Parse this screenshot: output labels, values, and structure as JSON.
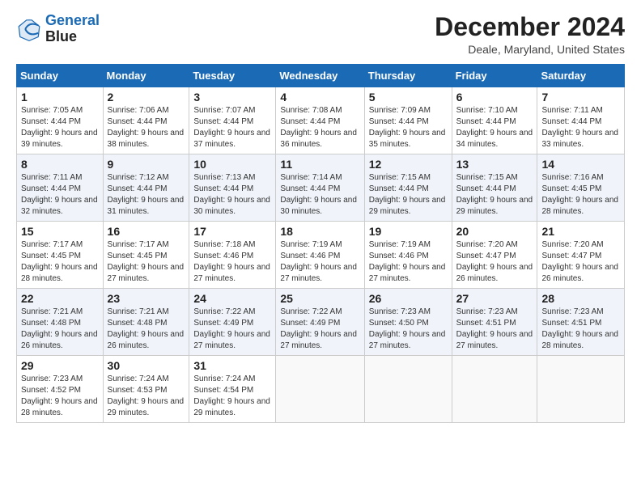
{
  "logo": {
    "line1": "General",
    "line2": "Blue"
  },
  "title": "December 2024",
  "location": "Deale, Maryland, United States",
  "days_of_week": [
    "Sunday",
    "Monday",
    "Tuesday",
    "Wednesday",
    "Thursday",
    "Friday",
    "Saturday"
  ],
  "weeks": [
    [
      {
        "day": "1",
        "sunrise": "7:05 AM",
        "sunset": "4:44 PM",
        "daylight": "9 hours and 39 minutes."
      },
      {
        "day": "2",
        "sunrise": "7:06 AM",
        "sunset": "4:44 PM",
        "daylight": "9 hours and 38 minutes."
      },
      {
        "day": "3",
        "sunrise": "7:07 AM",
        "sunset": "4:44 PM",
        "daylight": "9 hours and 37 minutes."
      },
      {
        "day": "4",
        "sunrise": "7:08 AM",
        "sunset": "4:44 PM",
        "daylight": "9 hours and 36 minutes."
      },
      {
        "day": "5",
        "sunrise": "7:09 AM",
        "sunset": "4:44 PM",
        "daylight": "9 hours and 35 minutes."
      },
      {
        "day": "6",
        "sunrise": "7:10 AM",
        "sunset": "4:44 PM",
        "daylight": "9 hours and 34 minutes."
      },
      {
        "day": "7",
        "sunrise": "7:11 AM",
        "sunset": "4:44 PM",
        "daylight": "9 hours and 33 minutes."
      }
    ],
    [
      {
        "day": "8",
        "sunrise": "7:11 AM",
        "sunset": "4:44 PM",
        "daylight": "9 hours and 32 minutes."
      },
      {
        "day": "9",
        "sunrise": "7:12 AM",
        "sunset": "4:44 PM",
        "daylight": "9 hours and 31 minutes."
      },
      {
        "day": "10",
        "sunrise": "7:13 AM",
        "sunset": "4:44 PM",
        "daylight": "9 hours and 30 minutes."
      },
      {
        "day": "11",
        "sunrise": "7:14 AM",
        "sunset": "4:44 PM",
        "daylight": "9 hours and 30 minutes."
      },
      {
        "day": "12",
        "sunrise": "7:15 AM",
        "sunset": "4:44 PM",
        "daylight": "9 hours and 29 minutes."
      },
      {
        "day": "13",
        "sunrise": "7:15 AM",
        "sunset": "4:44 PM",
        "daylight": "9 hours and 29 minutes."
      },
      {
        "day": "14",
        "sunrise": "7:16 AM",
        "sunset": "4:45 PM",
        "daylight": "9 hours and 28 minutes."
      }
    ],
    [
      {
        "day": "15",
        "sunrise": "7:17 AM",
        "sunset": "4:45 PM",
        "daylight": "9 hours and 28 minutes."
      },
      {
        "day": "16",
        "sunrise": "7:17 AM",
        "sunset": "4:45 PM",
        "daylight": "9 hours and 27 minutes."
      },
      {
        "day": "17",
        "sunrise": "7:18 AM",
        "sunset": "4:46 PM",
        "daylight": "9 hours and 27 minutes."
      },
      {
        "day": "18",
        "sunrise": "7:19 AM",
        "sunset": "4:46 PM",
        "daylight": "9 hours and 27 minutes."
      },
      {
        "day": "19",
        "sunrise": "7:19 AM",
        "sunset": "4:46 PM",
        "daylight": "9 hours and 27 minutes."
      },
      {
        "day": "20",
        "sunrise": "7:20 AM",
        "sunset": "4:47 PM",
        "daylight": "9 hours and 26 minutes."
      },
      {
        "day": "21",
        "sunrise": "7:20 AM",
        "sunset": "4:47 PM",
        "daylight": "9 hours and 26 minutes."
      }
    ],
    [
      {
        "day": "22",
        "sunrise": "7:21 AM",
        "sunset": "4:48 PM",
        "daylight": "9 hours and 26 minutes."
      },
      {
        "day": "23",
        "sunrise": "7:21 AM",
        "sunset": "4:48 PM",
        "daylight": "9 hours and 26 minutes."
      },
      {
        "day": "24",
        "sunrise": "7:22 AM",
        "sunset": "4:49 PM",
        "daylight": "9 hours and 27 minutes."
      },
      {
        "day": "25",
        "sunrise": "7:22 AM",
        "sunset": "4:49 PM",
        "daylight": "9 hours and 27 minutes."
      },
      {
        "day": "26",
        "sunrise": "7:23 AM",
        "sunset": "4:50 PM",
        "daylight": "9 hours and 27 minutes."
      },
      {
        "day": "27",
        "sunrise": "7:23 AM",
        "sunset": "4:51 PM",
        "daylight": "9 hours and 27 minutes."
      },
      {
        "day": "28",
        "sunrise": "7:23 AM",
        "sunset": "4:51 PM",
        "daylight": "9 hours and 28 minutes."
      }
    ],
    [
      {
        "day": "29",
        "sunrise": "7:23 AM",
        "sunset": "4:52 PM",
        "daylight": "9 hours and 28 minutes."
      },
      {
        "day": "30",
        "sunrise": "7:24 AM",
        "sunset": "4:53 PM",
        "daylight": "9 hours and 29 minutes."
      },
      {
        "day": "31",
        "sunrise": "7:24 AM",
        "sunset": "4:54 PM",
        "daylight": "9 hours and 29 minutes."
      },
      null,
      null,
      null,
      null
    ]
  ]
}
